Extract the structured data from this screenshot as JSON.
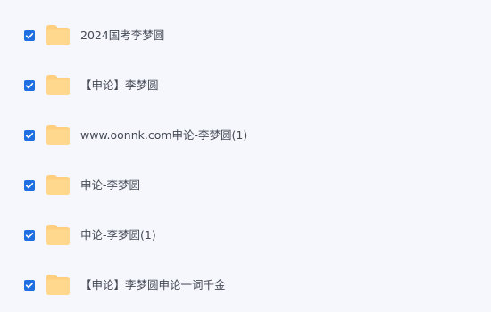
{
  "files": [
    {
      "name": "2024国考李梦圆",
      "checked": true,
      "icon": "folder-icon"
    },
    {
      "name": "【申论】李梦圆",
      "checked": true,
      "icon": "folder-icon"
    },
    {
      "name": "www.oonnk.com申论-李梦圆(1)",
      "checked": true,
      "icon": "folder-icon"
    },
    {
      "name": "申论-李梦圆",
      "checked": true,
      "icon": "folder-icon"
    },
    {
      "name": "申论-李梦圆(1)",
      "checked": true,
      "icon": "folder-icon"
    },
    {
      "name": "【申论】李梦圆申论一词千金",
      "checked": true,
      "icon": "folder-icon"
    }
  ],
  "colors": {
    "background": "#f6f7fd",
    "checkbox": "#1f6fe0",
    "folder": "#ffcf7f",
    "text": "#454a55"
  }
}
